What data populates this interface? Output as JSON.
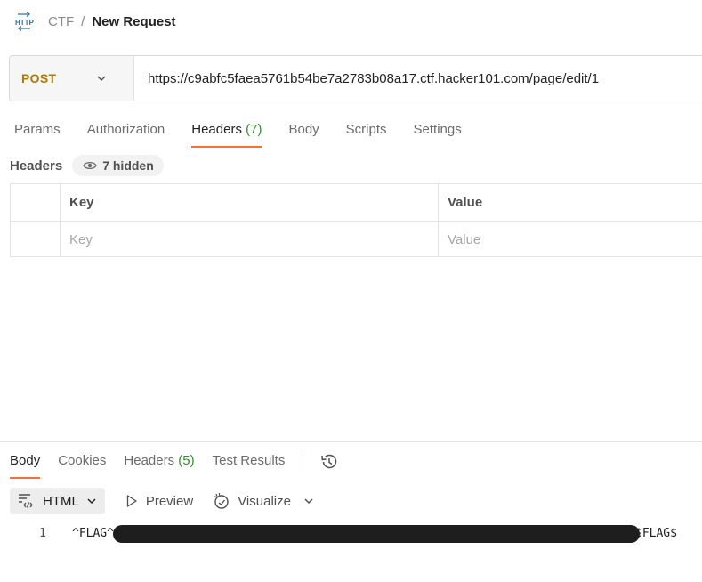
{
  "breadcrumb": {
    "icon": "http-icon",
    "parent": "CTF",
    "separator": "/",
    "current": "New Request"
  },
  "request": {
    "method": "POST",
    "url": "https://c9abfc5faea5761b54be7a2783b08a17.ctf.hacker101.com/page/edit/1"
  },
  "request_tabs": [
    {
      "label": "Params"
    },
    {
      "label": "Authorization"
    },
    {
      "label": "Headers",
      "count": "(7)",
      "active": true
    },
    {
      "label": "Body"
    },
    {
      "label": "Scripts"
    },
    {
      "label": "Settings"
    }
  ],
  "headers_section": {
    "title": "Headers",
    "hidden_label": "7 hidden",
    "columns": {
      "key": "Key",
      "value": "Value"
    },
    "placeholders": {
      "key": "Key",
      "value": "Value"
    }
  },
  "response_tabs": [
    {
      "label": "Body",
      "active": true
    },
    {
      "label": "Cookies"
    },
    {
      "label": "Headers",
      "count": "(5)"
    },
    {
      "label": "Test Results"
    }
  ],
  "response_toolbar": {
    "format": "HTML",
    "preview": "Preview",
    "visualize": "Visualize"
  },
  "response_body": {
    "line_number": "1",
    "text_start": "^FLAG^",
    "text_end": "$FLAG$"
  },
  "colors": {
    "method": "#ad7a03",
    "accent": "#ff6c37",
    "count": "#3a8b3a"
  }
}
